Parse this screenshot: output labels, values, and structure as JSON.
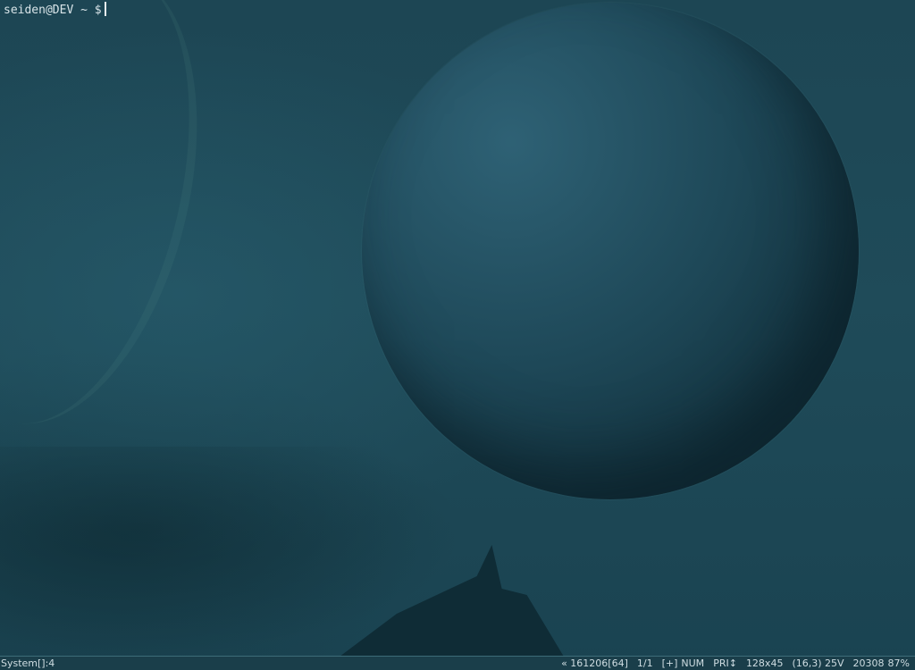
{
  "terminal": {
    "prompt": "seiden@DEV ~ $"
  },
  "statusbar": {
    "console_tab": "System[]:4",
    "history": "« 161206[64]",
    "page": "1/1",
    "plus": "[+]",
    "num": "NUM",
    "priority": "PRI↕",
    "size": "128x45",
    "cursor_pos": "(16,3) 25V",
    "pid": "20308",
    "zoom": "87%"
  }
}
